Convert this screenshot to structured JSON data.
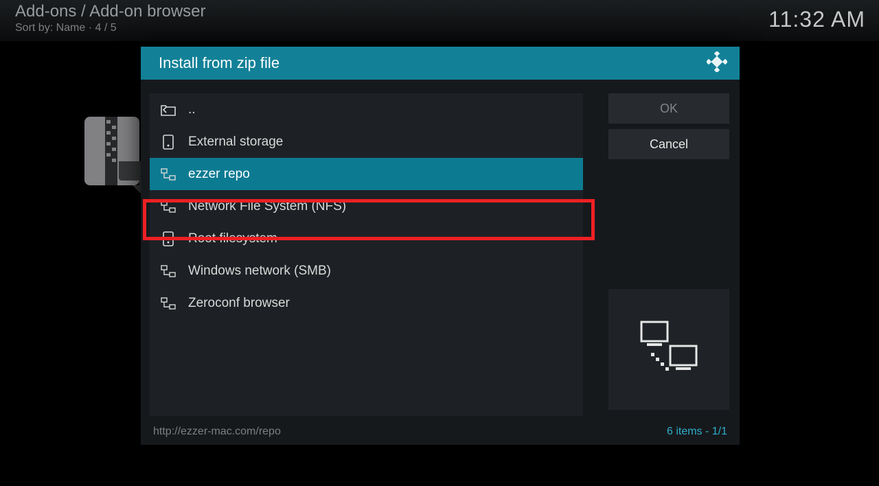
{
  "header": {
    "breadcrumb": "Add-ons / Add-on browser",
    "sortline": "Sort by: Name  ·  4 / 5",
    "clock": "11:32 AM"
  },
  "dialog": {
    "title": "Install from zip file",
    "items": [
      {
        "label": "..",
        "icon": "folder-up",
        "selected": false
      },
      {
        "label": "External storage",
        "icon": "drive",
        "selected": false
      },
      {
        "label": "ezzer repo",
        "icon": "network",
        "selected": true
      },
      {
        "label": "Network File System (NFS)",
        "icon": "network",
        "selected": false
      },
      {
        "label": "Root filesystem",
        "icon": "drive",
        "selected": false
      },
      {
        "label": "Windows network (SMB)",
        "icon": "network",
        "selected": false
      },
      {
        "label": "Zeroconf browser",
        "icon": "network",
        "selected": false
      }
    ],
    "buttons": {
      "ok": "OK",
      "cancel": "Cancel"
    },
    "footer": {
      "path": "http://ezzer-mac.com/repo",
      "count": "6 items - 1/1"
    }
  }
}
